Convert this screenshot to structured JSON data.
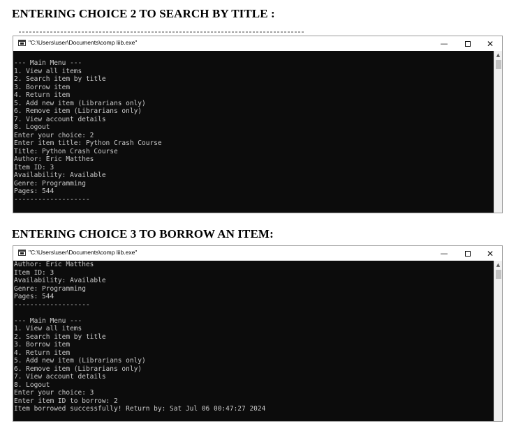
{
  "section_one": {
    "heading": "ENTERING CHOICE 2 TO SEARCH BY TITLE :",
    "window": {
      "title": "\"C:\\Users\\user\\Documents\\comp liib.exe\"",
      "minimize_glyph": "—",
      "close_glyph": "✕",
      "lines": [
        "--- Main Menu ---",
        "1. View all items",
        "2. Search item by title",
        "3. Borrow item",
        "4. Return item",
        "5. Add new item (Librarians only)",
        "6. Remove item (Librarians only)",
        "7. View account details",
        "8. Logout",
        "Enter your choice: 2",
        "Enter item title: Python Crash Course",
        "Title: Python Crash Course",
        "Author: Eric Matthes",
        "Item ID: 3",
        "Availability: Available",
        "Genre: Programming",
        "Pages: 544",
        "-------------------"
      ]
    }
  },
  "section_two": {
    "heading": "ENTERING CHOICE 3 TO BORROW AN ITEM:",
    "window": {
      "title": "\"C:\\Users\\user\\Documents\\comp liib.exe\"",
      "minimize_glyph": "—",
      "close_glyph": "✕",
      "lines": [
        "Author: Eric Matthes",
        "Item ID: 3",
        "Availability: Available",
        "Genre: Programming",
        "Pages: 544",
        "-------------------",
        "",
        "--- Main Menu ---",
        "1. View all items",
        "2. Search item by title",
        "3. Borrow item",
        "4. Return item",
        "5. Add new item (Librarians only)",
        "6. Remove item (Librarians only)",
        "7. View account details",
        "8. Logout",
        "Enter your choice: 3",
        "Enter item ID to borrow: 2",
        "Item borrowed successfully! Return by: Sat Jul 06 00:47:27 2024"
      ]
    }
  },
  "icons": {
    "app_icon": "console-app-icon",
    "minimize": "minimize-icon",
    "maximize": "maximize-icon",
    "close": "close-icon",
    "scroll_up": "chevron-up-icon"
  },
  "colors": {
    "console_background": "#0c0c0c",
    "console_text": "#cccccc",
    "titlebar_background": "#ffffff",
    "heading_text": "#000000"
  }
}
